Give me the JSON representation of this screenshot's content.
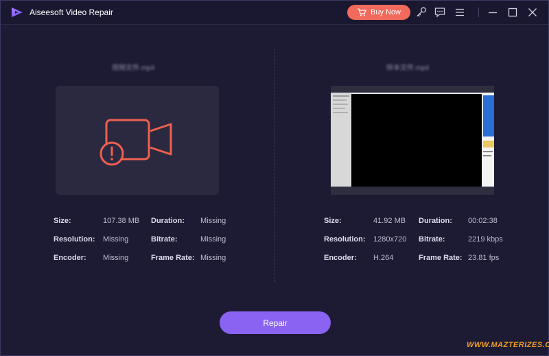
{
  "app": {
    "title": "Aiseesoft Video Repair",
    "buy_label": "Buy Now"
  },
  "left": {
    "file_name": "视频文件.mp4",
    "labels": {
      "size": "Size:",
      "duration": "Duration:",
      "resolution": "Resolution:",
      "bitrate": "Bitrate:",
      "encoder": "Encoder:",
      "frame_rate": "Frame Rate:"
    },
    "values": {
      "size": "107.38 MB",
      "duration": "Missing",
      "resolution": "Missing",
      "bitrate": "Missing",
      "encoder": "Missing",
      "frame_rate": "Missing"
    }
  },
  "right": {
    "file_name": "样本文件.mp4",
    "labels": {
      "size": "Size:",
      "duration": "Duration:",
      "resolution": "Resolution:",
      "bitrate": "Bitrate:",
      "encoder": "Encoder:",
      "frame_rate": "Frame Rate:"
    },
    "values": {
      "size": "41.92 MB",
      "duration": "00:02:38",
      "resolution": "1280x720",
      "bitrate": "2219 kbps",
      "encoder": "H.264",
      "frame_rate": "23.81 fps"
    }
  },
  "repair_label": "Repair",
  "watermark": "WWW.MAZTERIZES.COM",
  "colors": {
    "accent": "#8b63f2",
    "buy": "#f26a5c",
    "warning_icon": "#f0604f",
    "background": "#1d1b34"
  }
}
